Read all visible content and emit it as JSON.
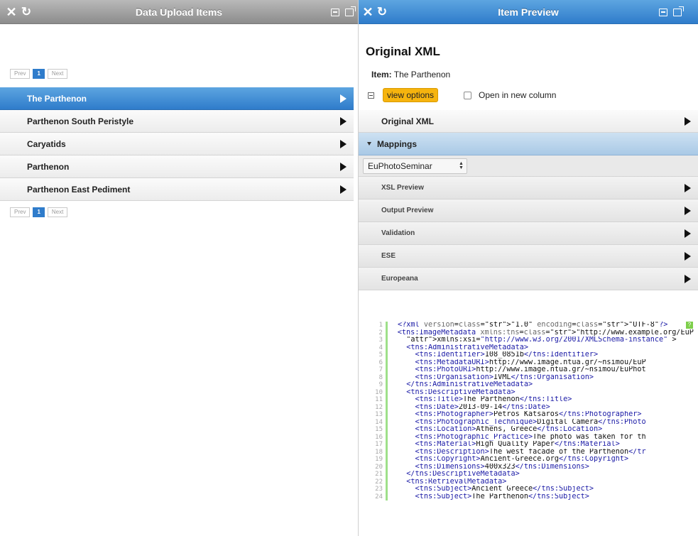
{
  "left": {
    "title": "Data Upload Items",
    "pager": {
      "prev": "Prev",
      "page": "1",
      "next": "Next"
    },
    "items": [
      "The Parthenon",
      "Parthenon South Peristyle",
      "Caryatids",
      "Parthenon",
      "Parthenon East Pediment"
    ],
    "selected_index": 0
  },
  "right": {
    "title": "Item Preview",
    "heading": "Original XML",
    "item_label": "Item:",
    "item_value": "The Parthenon",
    "view_options": "view options",
    "open_new_column": "Open in new column",
    "original_xml_row": "Original XML",
    "mappings_row": "Mappings",
    "mapping_select": "EuPhotoSeminar",
    "sub_rows": [
      "XSL Preview",
      "Output Preview",
      "Validation",
      "ESE",
      "Europeana"
    ],
    "code_lines": [
      "<?xml version=\"1.0\" encoding=\"UTF-8\"?>",
      "<tns:ImageMetadata xmlns:tns=\"http://www.example.org/EuPh",
      "  xmlns:xsi=\"http://www.w3.org/2001/XMLSchema-instance\" >",
      "  <tns:AdministrativeMetadata>",
      "    <tns:Identifier>108_0851b</tns:Identifier>",
      "    <tns:MetadataURI>http://www.image.ntua.gr/~nsimou/EuP",
      "    <tns:PhotoURI>http://www.image.ntua.gr/~nsimou/EuPhot",
      "    <tns:Organisation>IVML</tns:Organisation>",
      "  </tns:AdministrativeMetadata>",
      "  <tns:DescriptiveMetadata>",
      "    <tns:Title>The Parthenon</tns:Title>",
      "    <tns:Date>2013-09-14</tns:Date>",
      "    <tns:Photographer>Petros Katsaros</tns:Photographer>",
      "    <tns:Photographic_Technique>Digital Camera</tns:Photo",
      "    <tns:Location>Athens, Greece</tns:Location>",
      "    <tns:Photographic_Practice>The photo was taken for th",
      "    <tns:Material>High Quality Paper</tns:Material>",
      "    <tns:Description>The west facade of the Parthenon</tr",
      "    <tns:Copyright>Ancient-Greece.org</tns:Copyright>",
      "    <tns:Dimensions>400x323</tns:Dimensions>",
      "  </tns:DescriptiveMetadata>",
      "  <tns:RetrievalMetadata>",
      "    <tns:Subject>Ancient Greece</tns:Subject>",
      "    <tns:Subject>The Parthenon</tns:Subject>"
    ]
  },
  "icons": {
    "close": "close-icon",
    "refresh": "refresh-icon",
    "expand": "expand-icon",
    "share": "share-icon"
  },
  "colors": {
    "accent_blue": "#2f7ccb",
    "highlight_orange": "#f6b40e",
    "mapping_blue": "#a9c9e6"
  }
}
